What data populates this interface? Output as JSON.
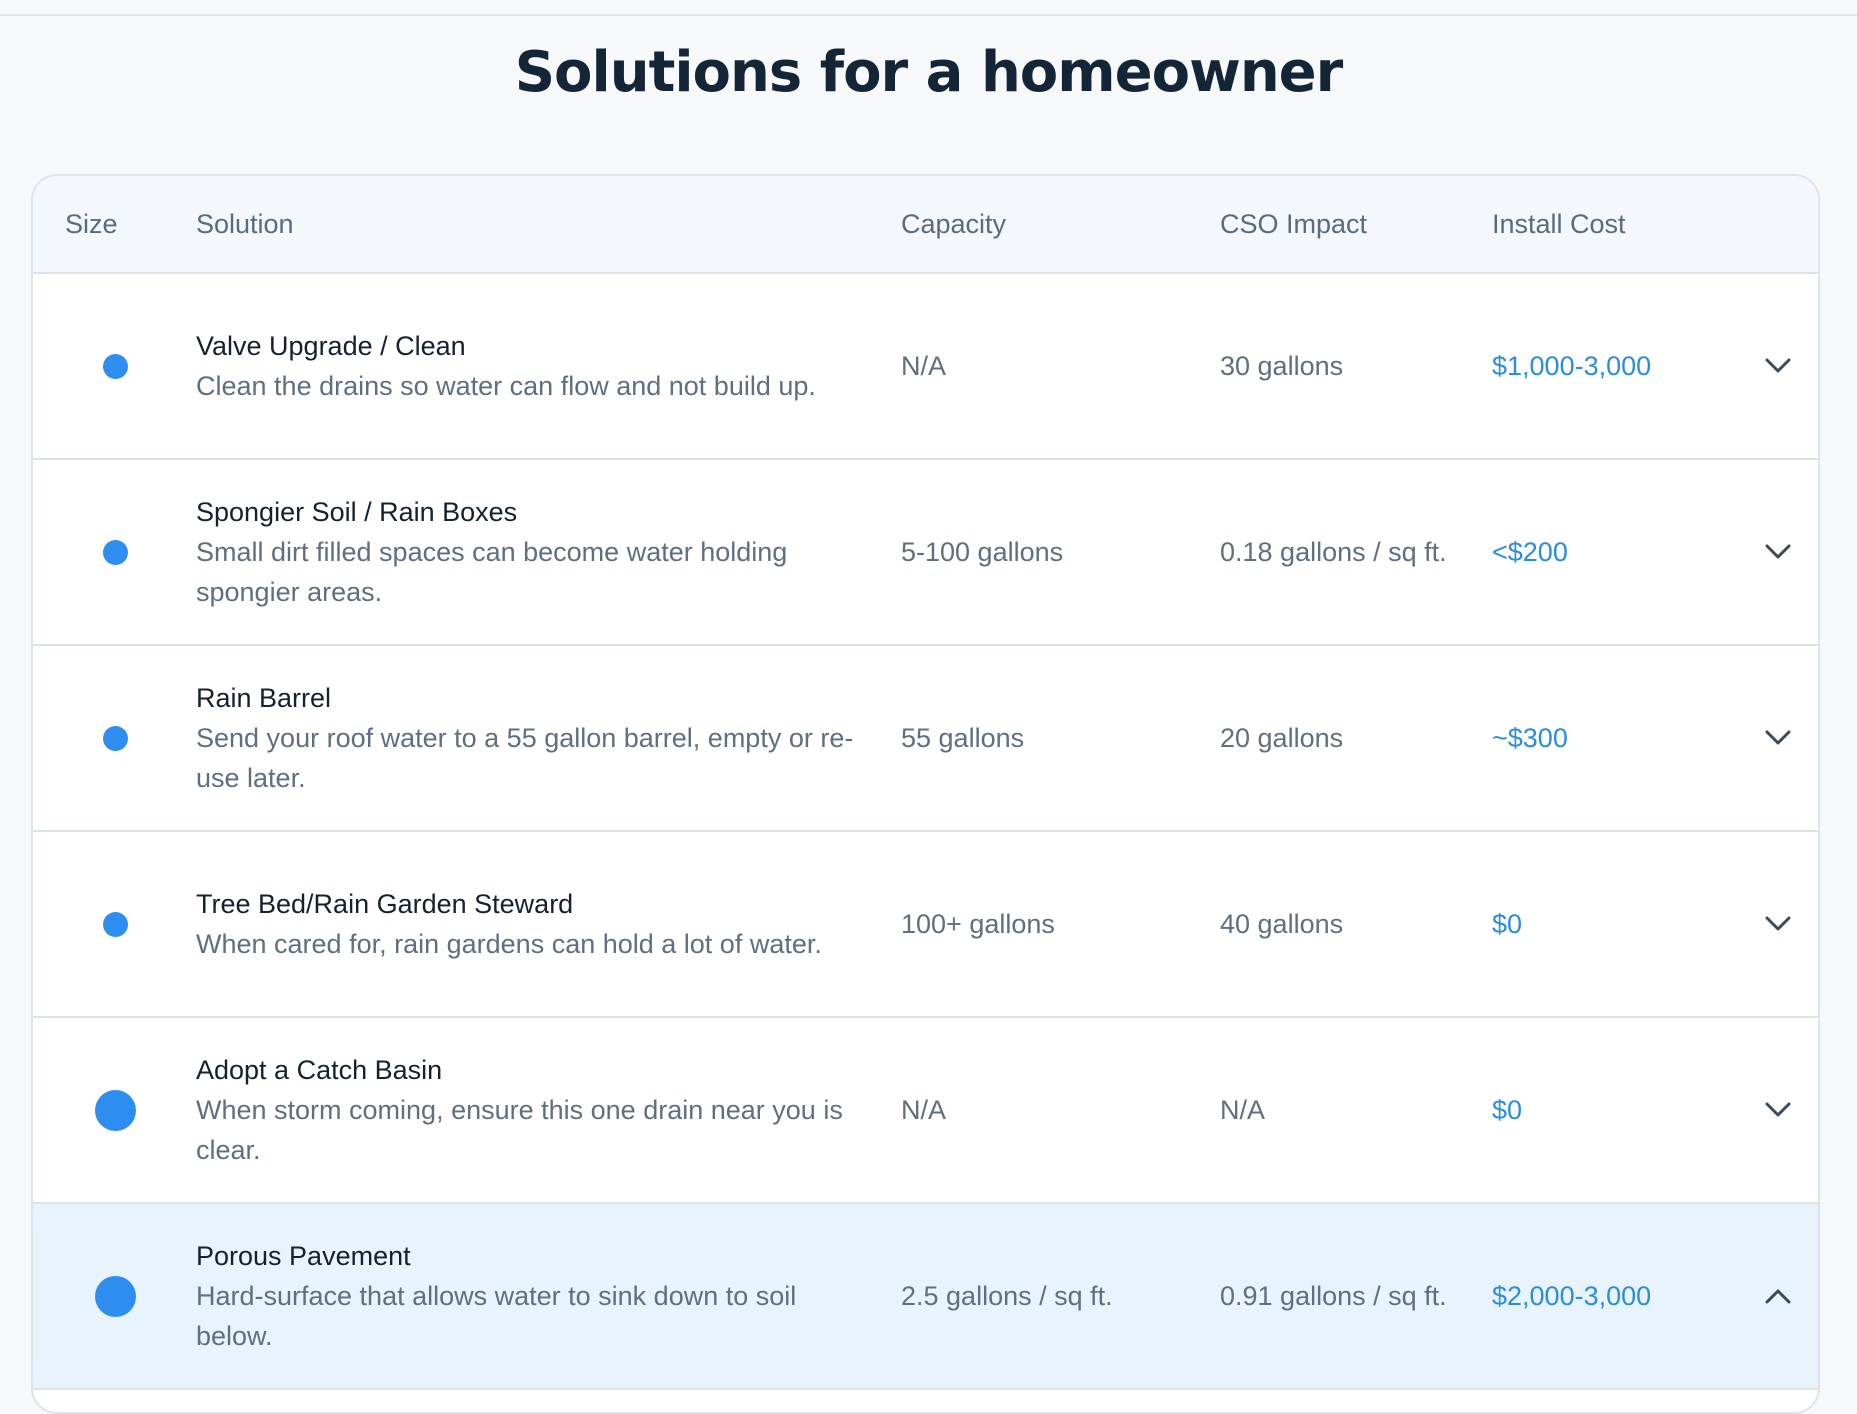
{
  "page": {
    "title": "Solutions for a homeowner"
  },
  "table": {
    "headers": {
      "size": "Size",
      "solution": "Solution",
      "capacity": "Capacity",
      "cso_impact": "CSO Impact",
      "install_cost": "Install Cost"
    },
    "rows": [
      {
        "size": "small",
        "name": "Valve Upgrade / Clean",
        "description": "Clean the drains so water can flow and not build up.",
        "capacity": "N/A",
        "cso_impact": "30 gallons",
        "install_cost": "$1,000-3,000",
        "expanded": false,
        "chevron": "chevron-down-icon"
      },
      {
        "size": "small",
        "name": "Spongier Soil / Rain Boxes",
        "description": "Small dirt filled spaces can become water holding spongier areas.",
        "capacity": "5-100 gallons",
        "cso_impact": "0.18 gallons / sq ft.",
        "install_cost": "<$200",
        "expanded": false,
        "chevron": "chevron-down-icon"
      },
      {
        "size": "small",
        "name": "Rain Barrel",
        "description": "Send your roof water to a 55 gallon barrel, empty or re-use later.",
        "capacity": "55 gallons",
        "cso_impact": "20 gallons",
        "install_cost": "~$300",
        "expanded": false,
        "chevron": "chevron-down-icon"
      },
      {
        "size": "small",
        "name": "Tree Bed/Rain Garden Steward",
        "description": "When cared for, rain gardens can hold a lot of water.",
        "capacity": "100+ gallons",
        "cso_impact": "40 gallons",
        "install_cost": "$0",
        "expanded": false,
        "chevron": "chevron-down-icon"
      },
      {
        "size": "large",
        "name": "Adopt a Catch Basin",
        "description": "When storm coming, ensure this one drain near you is clear.",
        "capacity": "N/A",
        "cso_impact": "N/A",
        "install_cost": "$0",
        "expanded": false,
        "chevron": "chevron-down-icon"
      },
      {
        "size": "large",
        "name": "Porous Pavement",
        "description": "Hard-surface that allows water to sink down to soil below.",
        "capacity": "2.5 gallons / sq ft.",
        "cso_impact": "0.91 gallons / sq ft.",
        "install_cost": "$2,000-3,000",
        "expanded": true,
        "chevron": "chevron-up-icon"
      }
    ]
  },
  "colors": {
    "accent": "#2e8ef0",
    "cost_text": "#2a8de0",
    "expanded_row_bg": "#e8f3fd"
  }
}
